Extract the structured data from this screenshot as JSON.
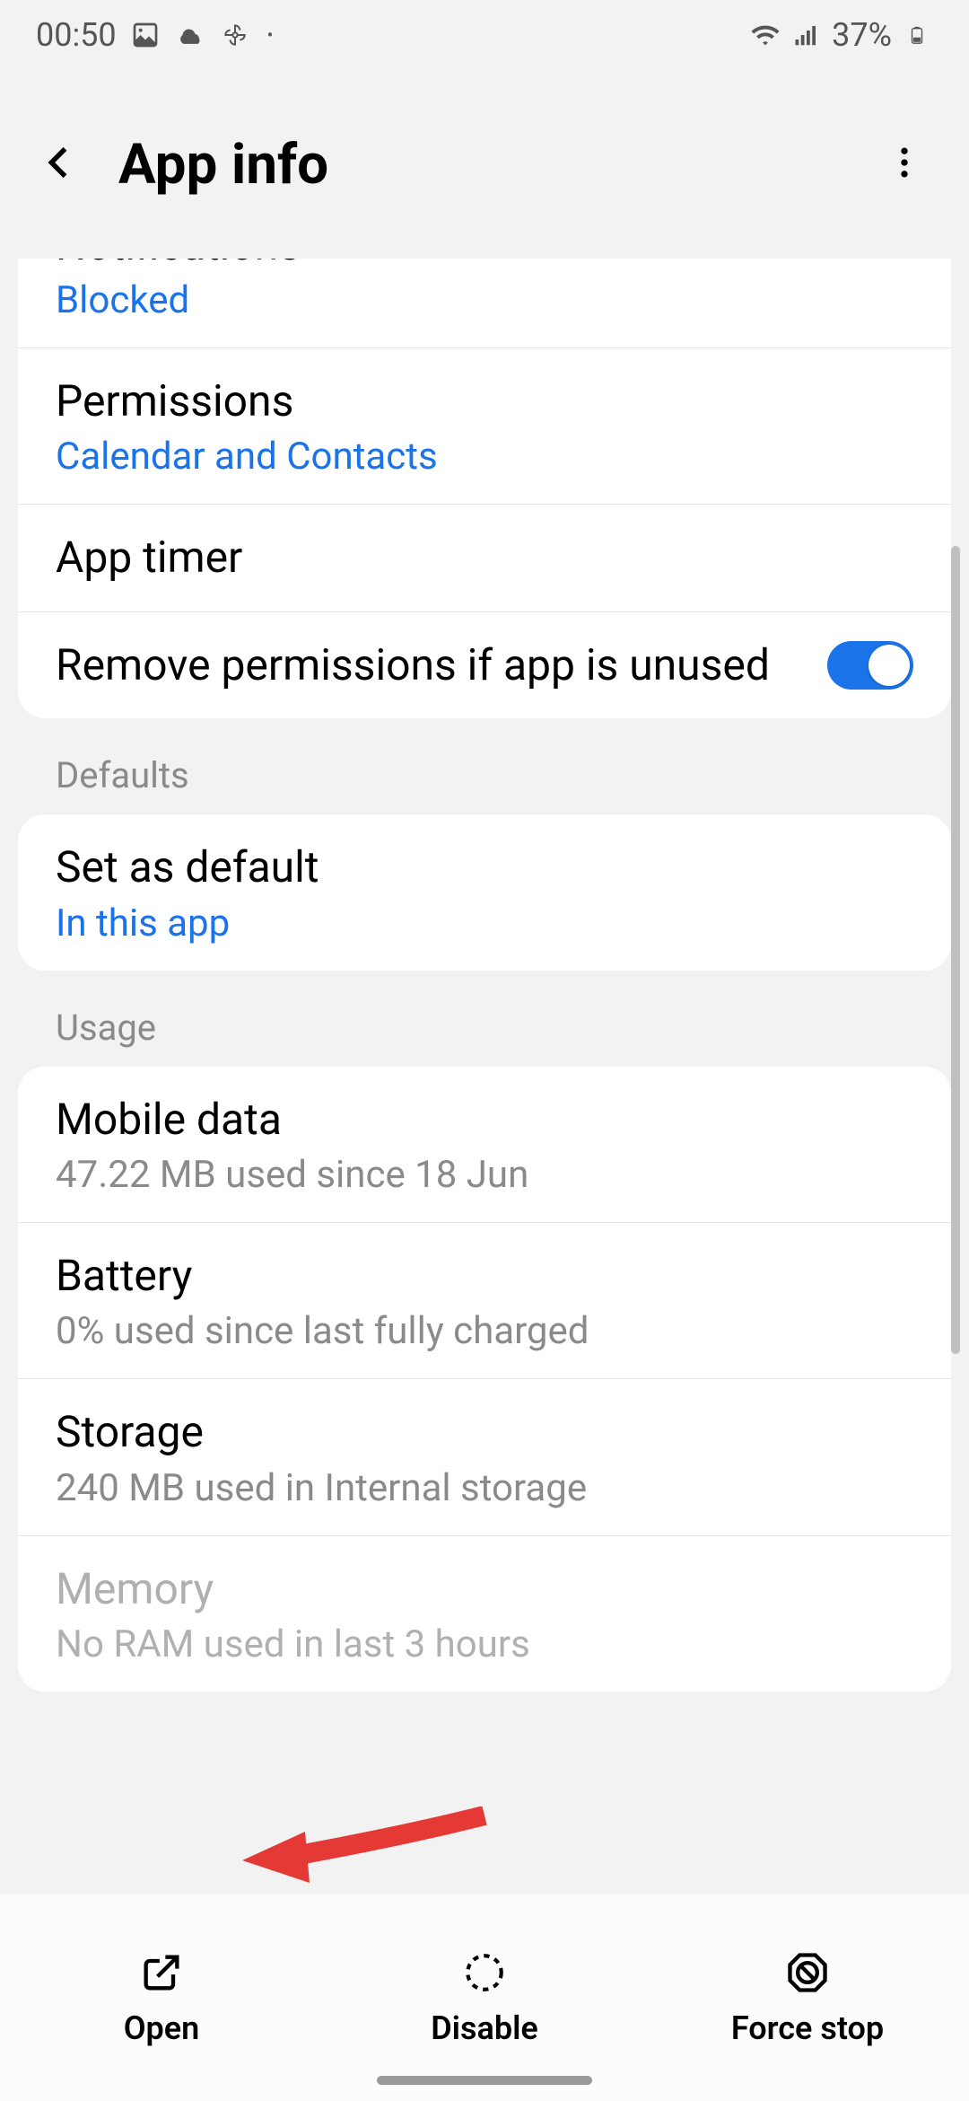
{
  "status": {
    "time": "00:50",
    "battery": "37%"
  },
  "header": {
    "title": "App info"
  },
  "items": {
    "notifications": {
      "title": "Notifications",
      "sub": "Blocked"
    },
    "permissions": {
      "title": "Permissions",
      "sub": "Calendar and Contacts"
    },
    "apptimer": {
      "title": "App timer"
    },
    "removeperms": {
      "title": "Remove permissions if app is unused"
    }
  },
  "sections": {
    "defaults": "Defaults",
    "usage": "Usage"
  },
  "defaults": {
    "setdefault": {
      "title": "Set as default",
      "sub": "In this app"
    }
  },
  "usage": {
    "mobiledata": {
      "title": "Mobile data",
      "sub": "47.22 MB used since 18 Jun"
    },
    "battery": {
      "title": "Battery",
      "sub": "0% used since last fully charged"
    },
    "storage": {
      "title": "Storage",
      "sub": "240 MB used in Internal storage"
    },
    "memory": {
      "title": "Memory",
      "sub": "No RAM used in last 3 hours"
    }
  },
  "actions": {
    "open": "Open",
    "disable": "Disable",
    "forcestop": "Force stop"
  }
}
